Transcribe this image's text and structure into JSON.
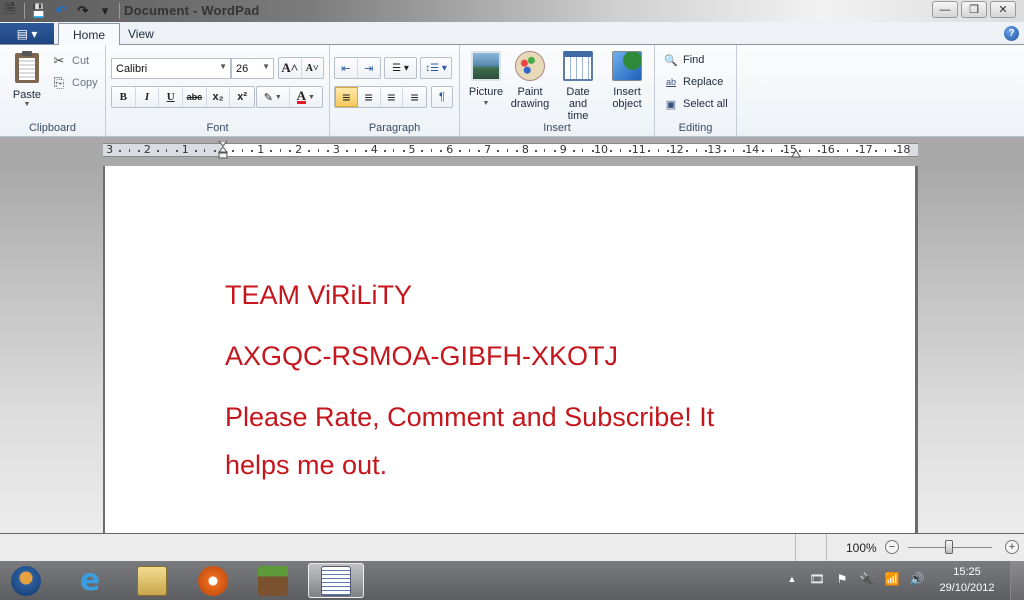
{
  "window": {
    "title": "Document - WordPad",
    "controls": {
      "minimize": "—",
      "restore": "❐",
      "close": "✕"
    }
  },
  "quick_access": {
    "items": [
      {
        "name": "app-icon",
        "glyph": "🗎"
      },
      {
        "name": "save-icon",
        "glyph": "💾"
      },
      {
        "name": "undo-icon",
        "glyph": "↶"
      },
      {
        "name": "redo-icon",
        "glyph": "↷"
      },
      {
        "name": "customize-icon",
        "glyph": "▾"
      }
    ]
  },
  "tabs": {
    "app_menu_glyph": "▤ ▾",
    "items": [
      {
        "label": "Home",
        "active": true
      },
      {
        "label": "View",
        "active": false
      }
    ],
    "help_glyph": "?"
  },
  "ribbon": {
    "clipboard": {
      "label": "Clipboard",
      "paste": "Paste",
      "cut": "Cut",
      "copy": "Copy",
      "cut_glyph": "✂",
      "copy_glyph": "⎘"
    },
    "font": {
      "label": "Font",
      "family": "Calibri",
      "size": "26",
      "grow_glyph": "A˄",
      "shrink_glyph": "A˅",
      "bold": "B",
      "italic": "I",
      "underline": "U",
      "strike": "abc",
      "subscript": "x₂",
      "superscript": "x²",
      "highlight_glyph": "✎",
      "font_color_glyph": "A",
      "font_color": "#e31b23"
    },
    "paragraph": {
      "label": "Paragraph",
      "decrease_indent": "⇤",
      "increase_indent": "⇥",
      "bullets": "☰ ▾",
      "line_spacing": "↕☰ ▾",
      "align_left": "≡",
      "align_center": "≡",
      "align_right": "≡",
      "justify": "≡",
      "paragraph_glyph": "¶"
    },
    "insert": {
      "label": "Insert",
      "picture": "Picture",
      "paint_drawing": [
        "Paint",
        "drawing"
      ],
      "date_time": [
        "Date and",
        "time"
      ],
      "insert_object": [
        "Insert",
        "object"
      ]
    },
    "editing": {
      "label": "Editing",
      "find": "Find",
      "replace": "Replace",
      "select_all": "Select all",
      "find_glyph": "🔍",
      "replace_glyph": "ab",
      "select_all_glyph": "▣"
    }
  },
  "ruler": {
    "labels": [
      "3",
      "2",
      "1",
      "1",
      "2",
      "3",
      "4",
      "5",
      "6",
      "7",
      "8",
      "9",
      "10",
      "11",
      "12",
      "13",
      "14",
      "15",
      "16",
      "17",
      "18"
    ]
  },
  "document": {
    "text_color": "#c4161c",
    "lines": [
      "TEAM ViRiLiTY",
      "AXGQC-RSMOA-GIBFH-XKOTJ",
      "Please Rate, Comment and Subscribe! It",
      "helps me out."
    ]
  },
  "statusbar": {
    "zoom": "100%",
    "zoom_out": "−",
    "zoom_in": "+",
    "zoom_level_percent": 100
  },
  "taskbar": {
    "start": "start-button",
    "apps": [
      {
        "name": "internet-explorer",
        "color": "#3a8fd9"
      },
      {
        "name": "windows-explorer",
        "color": "#e8c96a"
      },
      {
        "name": "media-player",
        "color": "#e0661f"
      },
      {
        "name": "minecraft",
        "color": "#6b4a2a"
      },
      {
        "name": "wordpad",
        "color": "#dfe6ef",
        "active": true
      }
    ],
    "tray": {
      "show_hidden": "▲",
      "icons": [
        "🎞",
        "⚑",
        "🔌",
        "📶",
        "🔊"
      ]
    },
    "time": "15:25",
    "date": "29/10/2012"
  }
}
